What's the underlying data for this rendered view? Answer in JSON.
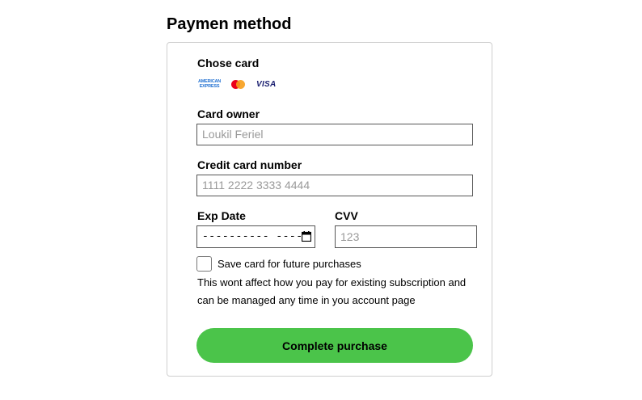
{
  "page": {
    "title": "Paymen method"
  },
  "card_select": {
    "label": "Chose card",
    "brands": {
      "amex_line1": "AMERICAN",
      "amex_line2": "EXPRESS",
      "visa": "VISA"
    }
  },
  "owner": {
    "label": "Card owner",
    "placeholder": "Loukil Feriel"
  },
  "number": {
    "label": "Credit card number",
    "placeholder": "1111 2222 3333 4444"
  },
  "expiry": {
    "label": "Exp Date",
    "mask": "----------  ----"
  },
  "cvv": {
    "label": "CVV",
    "placeholder": "123"
  },
  "save": {
    "label": "Save card for future purchases",
    "checked": false,
    "note": "This wont affect how you pay for existing subscription and can be managed any time in you account page"
  },
  "submit": {
    "label": "Complete purchase"
  },
  "colors": {
    "accent": "#4bc44a",
    "border": "#cfcfcf",
    "amex": "#1f6fd1",
    "visa": "#1a1f71",
    "mc_red": "#eb001b",
    "mc_orange": "#f79e1b"
  },
  "icons": {
    "expiry_picker": "calendar-icon"
  }
}
